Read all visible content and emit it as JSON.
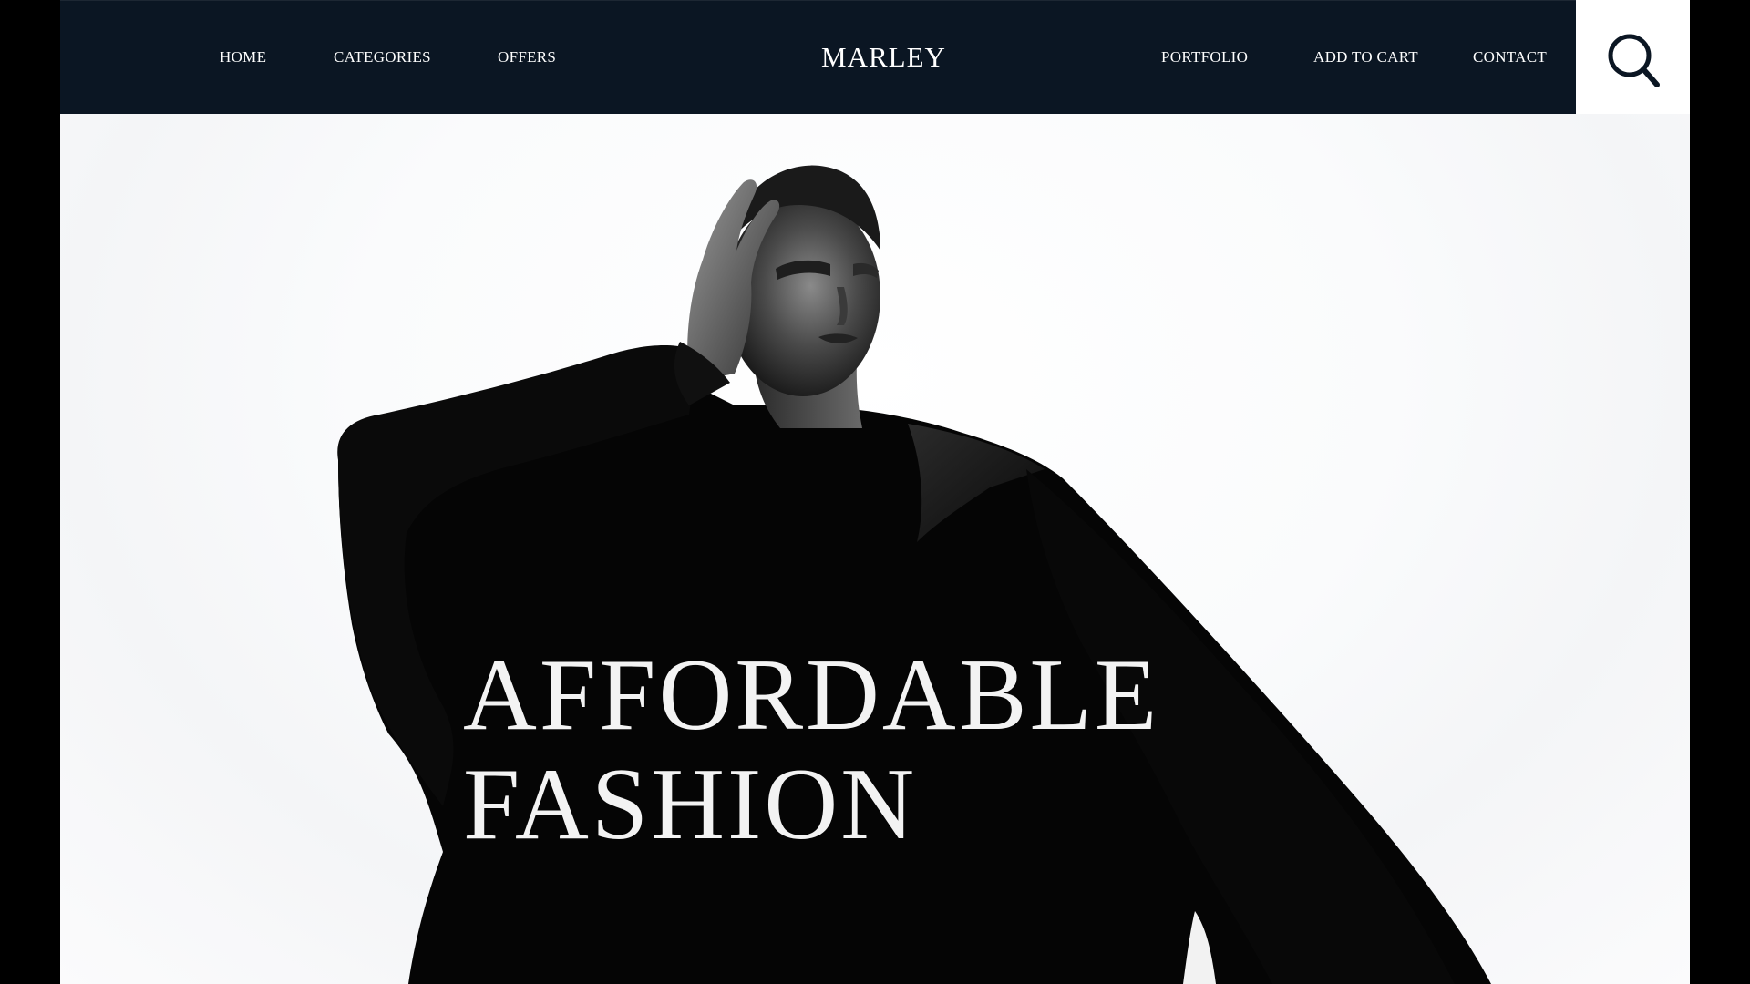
{
  "nav": {
    "left_links": [
      "HOME",
      "CATEGORIES",
      "OFFERS"
    ],
    "brand": "MARLEY",
    "right_links": [
      "PORTFOLIO",
      "ADD TO CART",
      "CONTACT"
    ],
    "search_icon": "search-icon"
  },
  "hero": {
    "headline_line1": "AFFORDABLE",
    "headline_line2": "FASHION",
    "image": "fashion-model-photo"
  },
  "colors": {
    "navbar_bg": "#0b1623",
    "nav_text": "#ffffff",
    "page_bg": "#ffffff",
    "outer_bg": "#000000",
    "headline_text": "#f3f3f3"
  }
}
